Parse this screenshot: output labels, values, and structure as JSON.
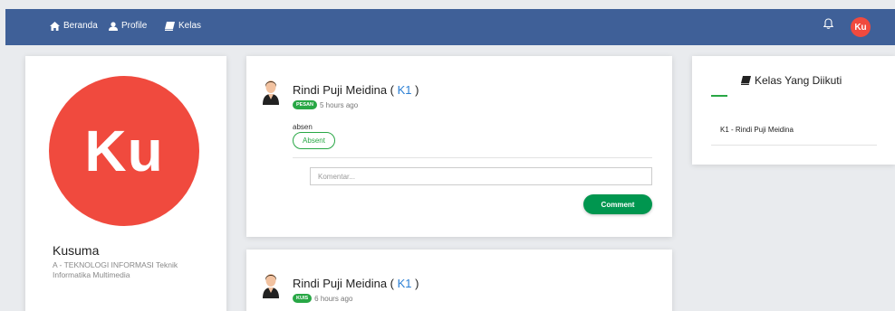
{
  "nav": {
    "items": [
      {
        "label": "Beranda",
        "icon": "home-icon"
      },
      {
        "label": "Profile",
        "icon": "user-icon"
      },
      {
        "label": "Kelas",
        "icon": "book-icon"
      }
    ],
    "notification_icon": "bell-icon",
    "avatar_initials": "Ku"
  },
  "profile": {
    "avatar_initials": "Ku",
    "name": "Kusuma",
    "subtitle": "A - TEKNOLOGI INFORMASI Teknik Informatika Multimedia"
  },
  "posts": [
    {
      "author": "Rindi Puji Meidina",
      "class_code": "K1",
      "badge": "PESAN",
      "time": "5 hours ago",
      "text": "absen",
      "action_label": "Absent",
      "comment_placeholder": "Komentar...",
      "comment_button": "Comment"
    },
    {
      "author": "Rindi Puji Meidina",
      "class_code": "K1",
      "badge": "KUIS",
      "time": "6 hours ago"
    }
  ],
  "classes": {
    "title": "Kelas Yang Diikuti",
    "items": [
      "K1 - Rindi Puji Meidina"
    ]
  },
  "colors": {
    "navbar": "#3f6098",
    "avatar": "#f04a3e",
    "accent_green": "#28a745",
    "comment_button": "#00964f",
    "link_blue": "#2a7fd4"
  }
}
